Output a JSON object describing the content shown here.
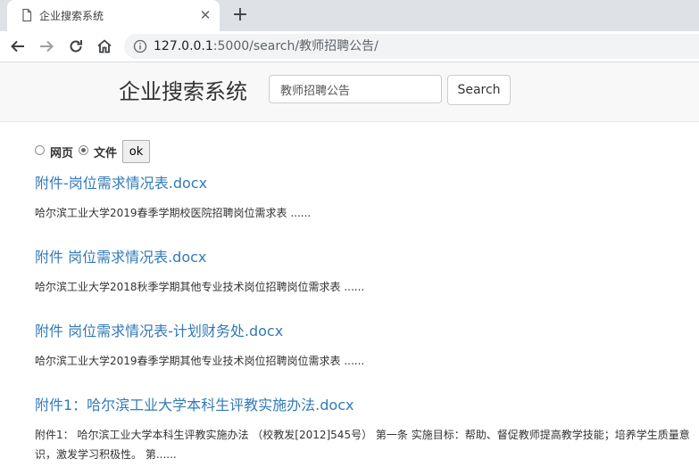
{
  "browser": {
    "tab_title": "企业搜索系统",
    "url_host": "127.0.0.1",
    "url_path": ":5000/search/教师招聘公告/"
  },
  "header": {
    "brand": "企业搜索系统",
    "search_value": "教师招聘公告",
    "search_button": "Search"
  },
  "filter": {
    "option_web": "网页",
    "option_file": "文件",
    "selected": "文件",
    "ok_label": "ok"
  },
  "results": [
    {
      "title": "附件-岗位需求情况表.docx",
      "snippet": "哈尔滨工业大学2019春季学期校医院招聘岗位需求表 ......"
    },
    {
      "title": "附件 岗位需求情况表.docx",
      "snippet": "哈尔滨工业大学2018秋季学期其他专业技术岗位招聘岗位需求表 ......"
    },
    {
      "title": "附件 岗位需求情况表-计划财务处.docx",
      "snippet": "哈尔滨工业大学2019春季学期其他专业技术岗位招聘岗位需求表 ......"
    },
    {
      "title": "附件1：哈尔滨工业大学本科生评教实施办法.docx",
      "snippet": "附件1：  哈尔滨工业大学本科生评教实施办法 （校教发[2012]545号） 第一条 实施目标：帮助、督促教师提高教学技能；培养学生质量意识，激发学习积极性。 第......"
    }
  ]
}
